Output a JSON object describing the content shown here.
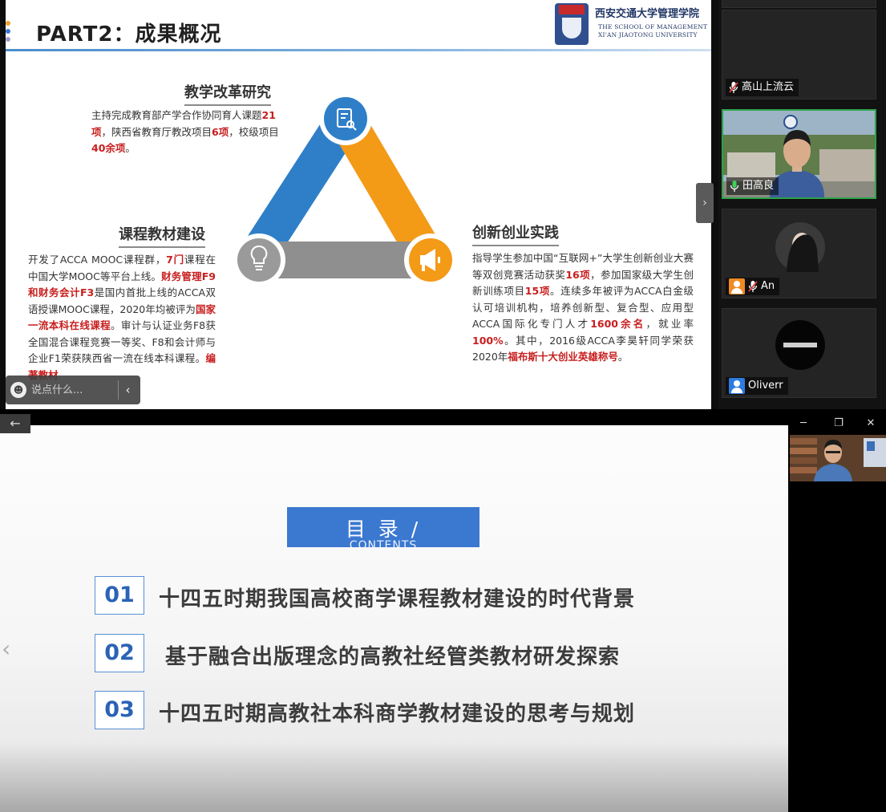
{
  "top": {
    "slide": {
      "title": "PART2：成果概况",
      "logo": {
        "cn": "西安交通大学管理学院",
        "en1": "THE SCHOOL OF MANAGEMENT",
        "en2": "XI'AN JIAOTONG UNIVERSITY"
      },
      "sections": {
        "teaching": {
          "heading": "教学改革研究",
          "parts": [
            {
              "t": "主持完成教育部产学合作协同育人课题"
            },
            {
              "t": "21项",
              "hl": true
            },
            {
              "t": "，陕西省教育厅教改项目"
            },
            {
              "t": "6项",
              "hl": true
            },
            {
              "t": "，校级项目"
            },
            {
              "t": "40余项",
              "hl": true
            },
            {
              "t": "。"
            }
          ]
        },
        "course": {
          "heading": "课程教材建设",
          "parts": [
            {
              "t": "开发了ACCA MOOC课程群，"
            },
            {
              "t": "7门",
              "hl": true
            },
            {
              "t": "课程在中国大学MOOC等平台上线。"
            },
            {
              "t": "财务管理F9和财务会计F3",
              "hl": true
            },
            {
              "t": "是国内首批上线的ACCA双语授课MOOC课程，2020年均被评为"
            },
            {
              "t": "国家一流本科在线课程",
              "hl": true
            },
            {
              "t": "。审计与认证业务F8获全国混合课程竞赛一等奖、F8和会计师与企业F1荣获陕西省一流在线本科课程。"
            },
            {
              "t": "编著教材",
              "hl": true
            }
          ]
        },
        "innovation": {
          "heading": "创新创业实践",
          "parts": [
            {
              "t": "指导学生参加中国“互联网+”大学生创新创业大赛等双创竞赛活动获奖"
            },
            {
              "t": "16项",
              "hl": true
            },
            {
              "t": "，参加国家级大学生创新训练项目"
            },
            {
              "t": "15项",
              "hl": true
            },
            {
              "t": "。连续多年被评为ACCA白金级认可培训机构，培养创新型、复合型、应用型ACCA国际化专门人才"
            },
            {
              "t": "1600余名",
              "hl": true
            },
            {
              "t": "，就业率"
            },
            {
              "t": "100%",
              "hl": true
            },
            {
              "t": "。其中，2016级ACCA李昊轩同学荣获2020年"
            },
            {
              "t": "福布斯十大创业英雄称号",
              "hl": true
            },
            {
              "t": "。"
            }
          ]
        }
      }
    },
    "chat": {
      "placeholder": "说点什么..."
    },
    "participants": [
      {
        "name": "高山上流云",
        "mic": "muted",
        "video": false
      },
      {
        "name": "田高良",
        "mic": "on",
        "video": true,
        "active": true
      },
      {
        "name": "An",
        "mic": "muted",
        "video": false,
        "avatar": true
      },
      {
        "name": "Oliverr",
        "mic": "none",
        "video": false,
        "avatar": true
      }
    ]
  },
  "bottom": {
    "slide": {
      "toc_title": "目 录 /",
      "toc_sub": "CONTENTS",
      "items": [
        {
          "num": "01",
          "text": "十四五时期我国高校商学课程教材建设的时代背景"
        },
        {
          "num": "02",
          "text": "基于融合出版理念的高教社经管类教材研发探索"
        },
        {
          "num": "03",
          "text": "十四五时期高教社本科商学教材建设的思考与规划"
        }
      ]
    }
  },
  "icons": {
    "chevron": "‹",
    "expand": "›",
    "back": "←",
    "minimize": "─",
    "restore": "❐",
    "close": "✕",
    "emoji": "☻"
  },
  "colors": {
    "accent_blue": "#3b78d0",
    "highlight_red": "#c81e1e",
    "triangle_blue": "#2f7fc8",
    "triangle_orange": "#f39a17",
    "triangle_gray": "#8f8f8f",
    "active_speaker": "#2ea34a"
  }
}
